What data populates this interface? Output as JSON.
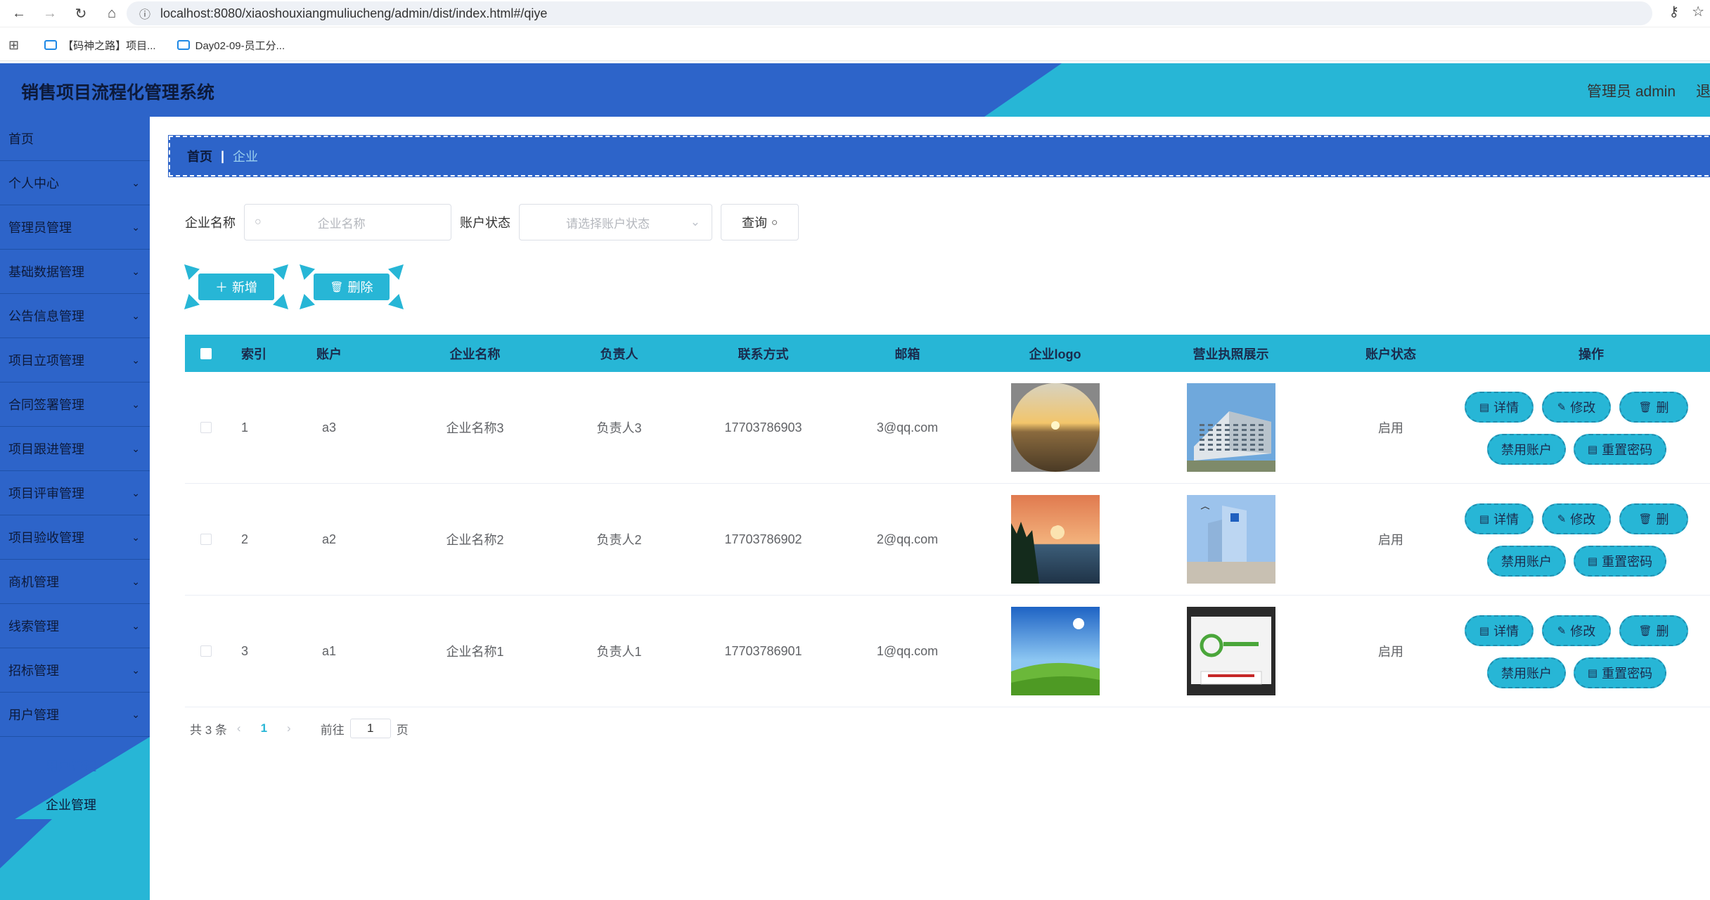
{
  "browser": {
    "url": "localhost:8080/xiaoshouxiangmuliucheng/admin/dist/index.html#/qiye",
    "bookmarks": [
      "【码神之路】项目...",
      "Day02-09-员工分..."
    ]
  },
  "header": {
    "title": "销售项目流程化管理系统",
    "user": "管理员 admin",
    "logout": "退"
  },
  "sidebar": {
    "items": [
      {
        "label": "首页",
        "has_arrow": false
      },
      {
        "label": "个人中心",
        "has_arrow": true
      },
      {
        "label": "管理员管理",
        "has_arrow": true
      },
      {
        "label": "基础数据管理",
        "has_arrow": true
      },
      {
        "label": "公告信息管理",
        "has_arrow": true
      },
      {
        "label": "项目立项管理",
        "has_arrow": true
      },
      {
        "label": "合同签署管理",
        "has_arrow": true
      },
      {
        "label": "项目跟进管理",
        "has_arrow": true
      },
      {
        "label": "项目评审管理",
        "has_arrow": true
      },
      {
        "label": "项目验收管理",
        "has_arrow": true
      },
      {
        "label": "商机管理",
        "has_arrow": true
      },
      {
        "label": "线索管理",
        "has_arrow": true
      },
      {
        "label": "招标管理",
        "has_arrow": true
      },
      {
        "label": "用户管理",
        "has_arrow": true
      }
    ],
    "sub_items": [
      "用户管理",
      "企业管理"
    ]
  },
  "breadcrumb": {
    "home": "首页",
    "separator": "|",
    "current": "企业"
  },
  "search": {
    "name_label": "企业名称",
    "name_placeholder": "企业名称",
    "status_label": "账户状态",
    "status_placeholder": "请选择账户状态",
    "query_button": "查询"
  },
  "actions": {
    "add": "新增",
    "delete": "删除"
  },
  "table": {
    "columns": [
      "索引",
      "账户",
      "企业名称",
      "负责人",
      "联系方式",
      "邮箱",
      "企业logo",
      "营业执照展示",
      "账户状态",
      "操作"
    ],
    "rows": [
      {
        "index": "1",
        "account": "a3",
        "name": "企业名称3",
        "owner": "负责人3",
        "phone": "17703786903",
        "email": "3@qq.com",
        "status": "启用",
        "logo": "sunset-desert",
        "license": "office-building"
      },
      {
        "index": "2",
        "account": "a2",
        "name": "企业名称2",
        "owner": "负责人2",
        "phone": "17703786902",
        "email": "2@qq.com",
        "status": "启用",
        "logo": "lake-dusk",
        "license": "glass-tower"
      },
      {
        "index": "3",
        "account": "a1",
        "name": "企业名称1",
        "owner": "负责人1",
        "phone": "17703786901",
        "email": "1@qq.com",
        "status": "启用",
        "logo": "green-hills",
        "license": "reception-desk"
      }
    ],
    "row_buttons": {
      "detail": "详情",
      "edit": "修改",
      "delete": "删",
      "disable": "禁用账户",
      "reset": "重置密码"
    }
  },
  "pagination": {
    "total": "共 3 条",
    "current": "1",
    "goto_label": "前往",
    "goto_value": "1",
    "page_suffix": "页"
  },
  "colors": {
    "primary_blue": "#2d64c9",
    "accent_cyan": "#27b6d6"
  }
}
